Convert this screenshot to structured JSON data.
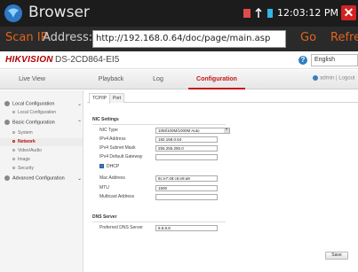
{
  "app": {
    "title": "Browser",
    "time": "12:03:12 PM",
    "close_glyph": "✕"
  },
  "browser": {
    "scan_label": "Scan IP",
    "address_label": "Address:",
    "url": "http://192.168.0.64/doc/page/main.asp",
    "go_label": "Go",
    "refresh_label": "Refresh"
  },
  "header": {
    "logo": "HIKVISION",
    "model": "DS-2CD864-EI5",
    "help_glyph": "?",
    "language": "English"
  },
  "nav": {
    "items": [
      "Live View",
      "Playback",
      "Log",
      "Configuration"
    ],
    "active": "Configuration",
    "user": "admin",
    "separator": "|",
    "logout": "Logout"
  },
  "sidebar": {
    "local_config": "Local Configuration",
    "local_config_item": "Local Configuration",
    "basic_config": "Basic Configuration",
    "items": [
      "System",
      "Network",
      "Video/Audio",
      "Image",
      "Security"
    ],
    "active_item": "Network",
    "advanced_config": "Advanced Configuration",
    "chevron_glyph": "⌄",
    "collapse_glyph": "⌃"
  },
  "tabs": [
    "TCP/IP",
    "Port"
  ],
  "nic": {
    "section_title": "NIC Settings",
    "nic_type_label": "NIC Type",
    "nic_type_value": "10M/100M/1000M Auto",
    "ipv4_label": "IPv4 Address",
    "ipv4_value": "192.168.0.64",
    "mask_label": "IPv4 Subnet Mask",
    "mask_value": "255.255.255.0",
    "gateway_label": "IPv4 Default Gateway",
    "gateway_value": "",
    "dhcp_label": "DHCP",
    "dhcp_checked": true,
    "mac_label": "Mac Address",
    "mac_value": "8c:e7:48:c6:e9:a9",
    "mtu_label": "MTU",
    "mtu_value": "1500",
    "multicast_label": "Multicast Address",
    "multicast_value": ""
  },
  "dns": {
    "section_title": "DNS Server",
    "preferred_label": "Preferred DNS Server",
    "preferred_value": "8.8.8.8"
  },
  "save_label": "Save",
  "colors": {
    "accent_orange": "#e0641f",
    "brand_red": "#b00000",
    "active_nav": "#c41818",
    "close_red": "#d32222"
  }
}
